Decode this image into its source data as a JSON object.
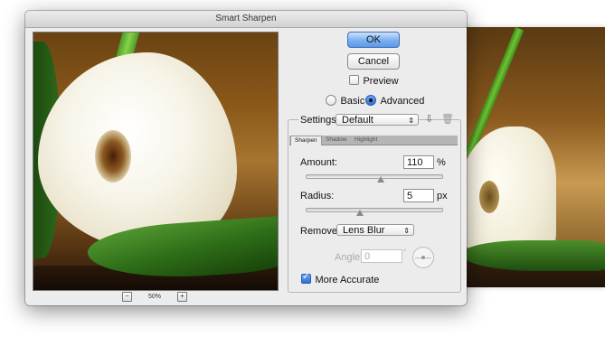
{
  "window": {
    "title": "Smart Sharpen"
  },
  "preview": {
    "zoom_out_icon": "zoom-out-icon",
    "zoom_level": "50%",
    "zoom_in_icon": "zoom-in-icon"
  },
  "buttons": {
    "ok": "OK",
    "cancel": "Cancel"
  },
  "preview_toggle": {
    "label": "Preview",
    "checked": false
  },
  "mode": {
    "basic": "Basic",
    "advanced": "Advanced",
    "selected": "Advanced"
  },
  "settings": {
    "label": "Settings:",
    "value": "Default",
    "save_icon": "save-settings-icon",
    "delete_icon": "trash-icon"
  },
  "tabs": [
    {
      "label": "Sharpen",
      "active": true
    },
    {
      "label": "Shadow",
      "active": false
    },
    {
      "label": "Highlight",
      "active": false
    }
  ],
  "amount": {
    "label": "Amount:",
    "value": "110",
    "unit": "%",
    "slider_fraction": 0.55
  },
  "radius": {
    "label": "Radius:",
    "value": "5",
    "unit": "px",
    "slider_fraction": 0.4
  },
  "remove": {
    "label": "Remove:",
    "value": "Lens Blur"
  },
  "angle": {
    "label": "Angle:",
    "value": "0",
    "unit": "°"
  },
  "more_accurate": {
    "label": "More Accurate",
    "checked": true
  }
}
